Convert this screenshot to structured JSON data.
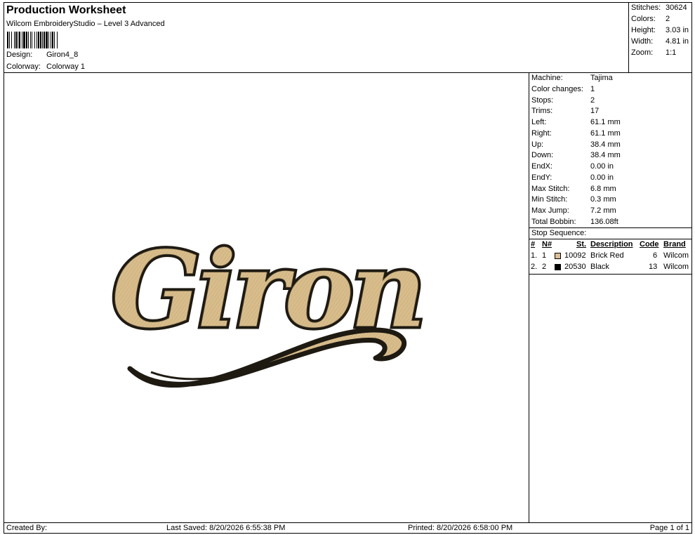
{
  "header": {
    "title": "Production Worksheet",
    "subtitle": "Wilcom EmbroideryStudio – Level 3 Advanced",
    "design_label": "Design:",
    "design_value": "Giron4_8",
    "colorway_label": "Colorway:",
    "colorway_value": "Colorway 1"
  },
  "stats": [
    {
      "label": "Stitches:",
      "value": "30624"
    },
    {
      "label": "Colors:",
      "value": "2"
    },
    {
      "label": "Height:",
      "value": "3.03 in"
    },
    {
      "label": "Width:",
      "value": "4.81 in"
    },
    {
      "label": "Zoom:",
      "value": "1:1"
    }
  ],
  "machine_info": [
    {
      "label": "Machine:",
      "value": "Tajima"
    },
    {
      "label": "Color changes:",
      "value": "1"
    },
    {
      "label": "Stops:",
      "value": "2"
    },
    {
      "label": "Trims:",
      "value": "17"
    },
    {
      "label": "Left:",
      "value": "61.1 mm"
    },
    {
      "label": "Right:",
      "value": "61.1 mm"
    },
    {
      "label": "Up:",
      "value": "38.4 mm"
    },
    {
      "label": "Down:",
      "value": "38.4 mm"
    },
    {
      "label": "EndX:",
      "value": "0.00 in"
    },
    {
      "label": "EndY:",
      "value": "0.00 in"
    },
    {
      "label": "Max Stitch:",
      "value": "6.8 mm"
    },
    {
      "label": "Min Stitch:",
      "value": "0.3 mm"
    },
    {
      "label": "Max Jump:",
      "value": "7.2 mm"
    },
    {
      "label": "Total Bobbin:",
      "value": "136.08ft"
    }
  ],
  "stop_sequence": {
    "label": "Stop Sequence:",
    "headers": {
      "num": "#",
      "n": "N#",
      "st": "St.",
      "description": "Description",
      "code": "Code",
      "brand": "Brand"
    },
    "rows": [
      {
        "num": "1.",
        "n": "1",
        "color": "#dcbf96",
        "st": "10092",
        "description": "Brick Red",
        "code": "6",
        "brand": "Wilcom"
      },
      {
        "num": "2.",
        "n": "2",
        "color": "#000000",
        "st": "20530",
        "description": "Black",
        "code": "13",
        "brand": "Wilcom"
      }
    ]
  },
  "design_preview": {
    "text": "Giron",
    "fill_color": "#d8bd8c",
    "outline_color": "#1e1a12"
  },
  "footer": {
    "created_by": "Created By:",
    "last_saved": "Last Saved: 8/20/2026 6:55:38 PM",
    "printed": "Printed: 8/20/2026 6:58:00 PM",
    "page": "Page 1 of 1"
  }
}
